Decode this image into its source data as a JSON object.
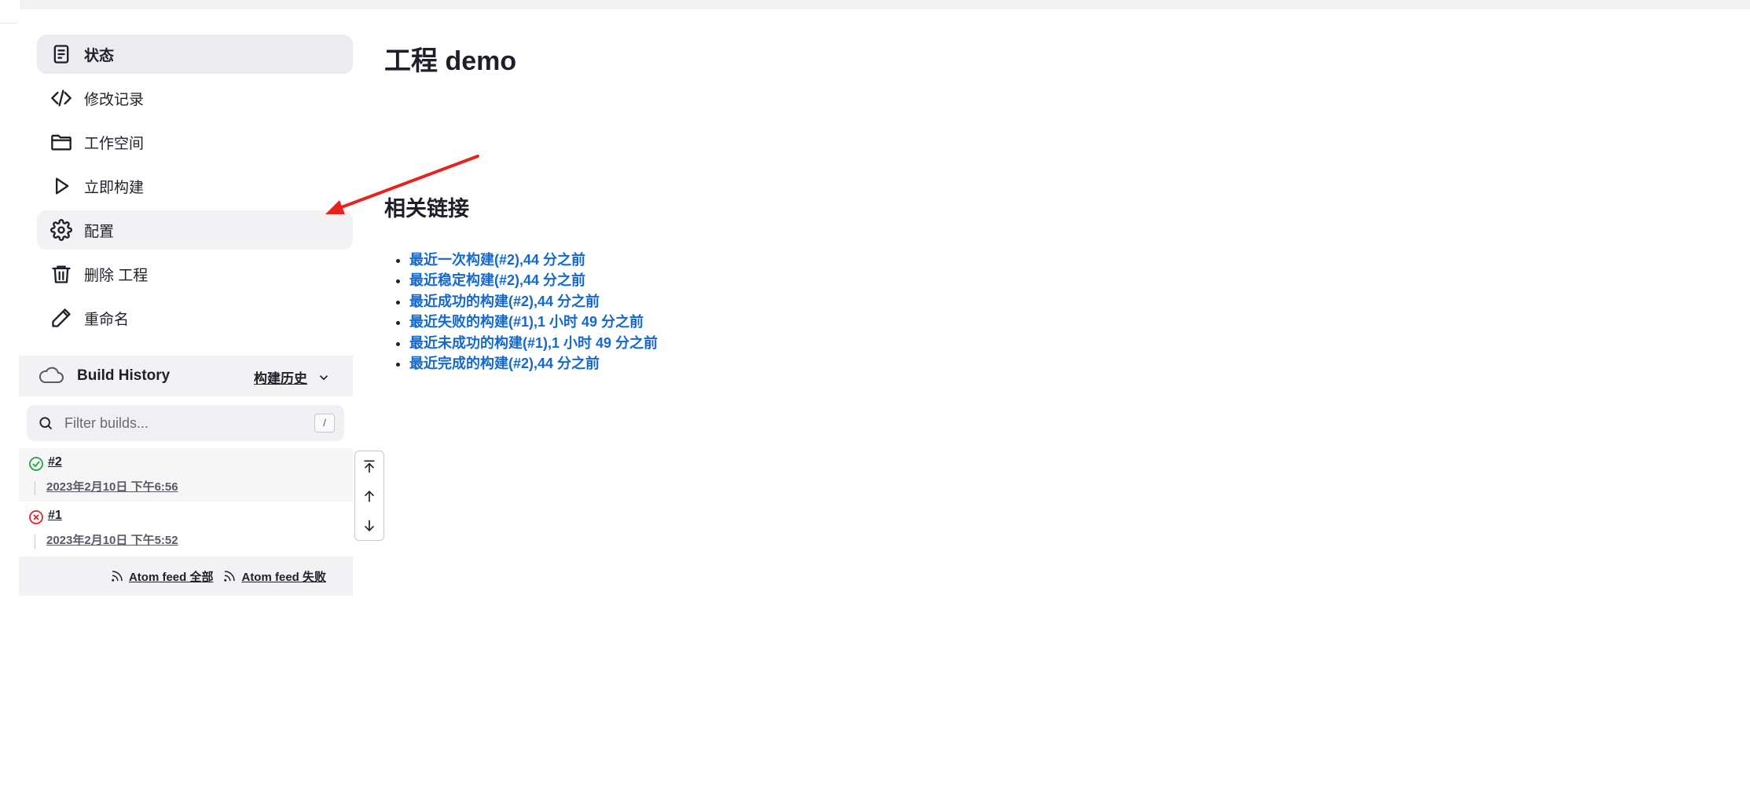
{
  "nav": {
    "items": [
      {
        "label": "状态",
        "icon": "document-icon"
      },
      {
        "label": "修改记录",
        "icon": "code-icon"
      },
      {
        "label": "工作空间",
        "icon": "folder-icon"
      },
      {
        "label": "立即构建",
        "icon": "play-icon"
      },
      {
        "label": "配置",
        "icon": "gear-icon"
      },
      {
        "label": "删除 工程",
        "icon": "trash-icon"
      },
      {
        "label": "重命名",
        "icon": "pencil-icon"
      }
    ]
  },
  "build_history": {
    "title": "Build History",
    "trend_label": "构建历史",
    "filter_placeholder": "Filter builds...",
    "shortcut": "/",
    "builds": [
      {
        "number": "#2",
        "date": "2023年2月10日 下午6:56",
        "status": "success"
      },
      {
        "number": "#1",
        "date": "2023年2月10日 下午5:52",
        "status": "failed"
      }
    ],
    "feeds": {
      "all": "Atom feed 全部",
      "failed": "Atom feed 失败"
    }
  },
  "main": {
    "title": "工程 demo",
    "section_title": "相关链接",
    "links": [
      "最近一次构建(#2),44 分之前",
      "最近稳定构建(#2),44 分之前",
      "最近成功的构建(#2),44 分之前",
      "最近失败的构建(#1),1 小时 49 分之前",
      "最近未成功的构建(#1),1 小时 49 分之前",
      "最近完成的构建(#2),44 分之前"
    ]
  },
  "colors": {
    "link": "#1469cc",
    "success": "#1ea446",
    "failure": "#e0242d",
    "annotation_arrow": "#e8231f"
  }
}
